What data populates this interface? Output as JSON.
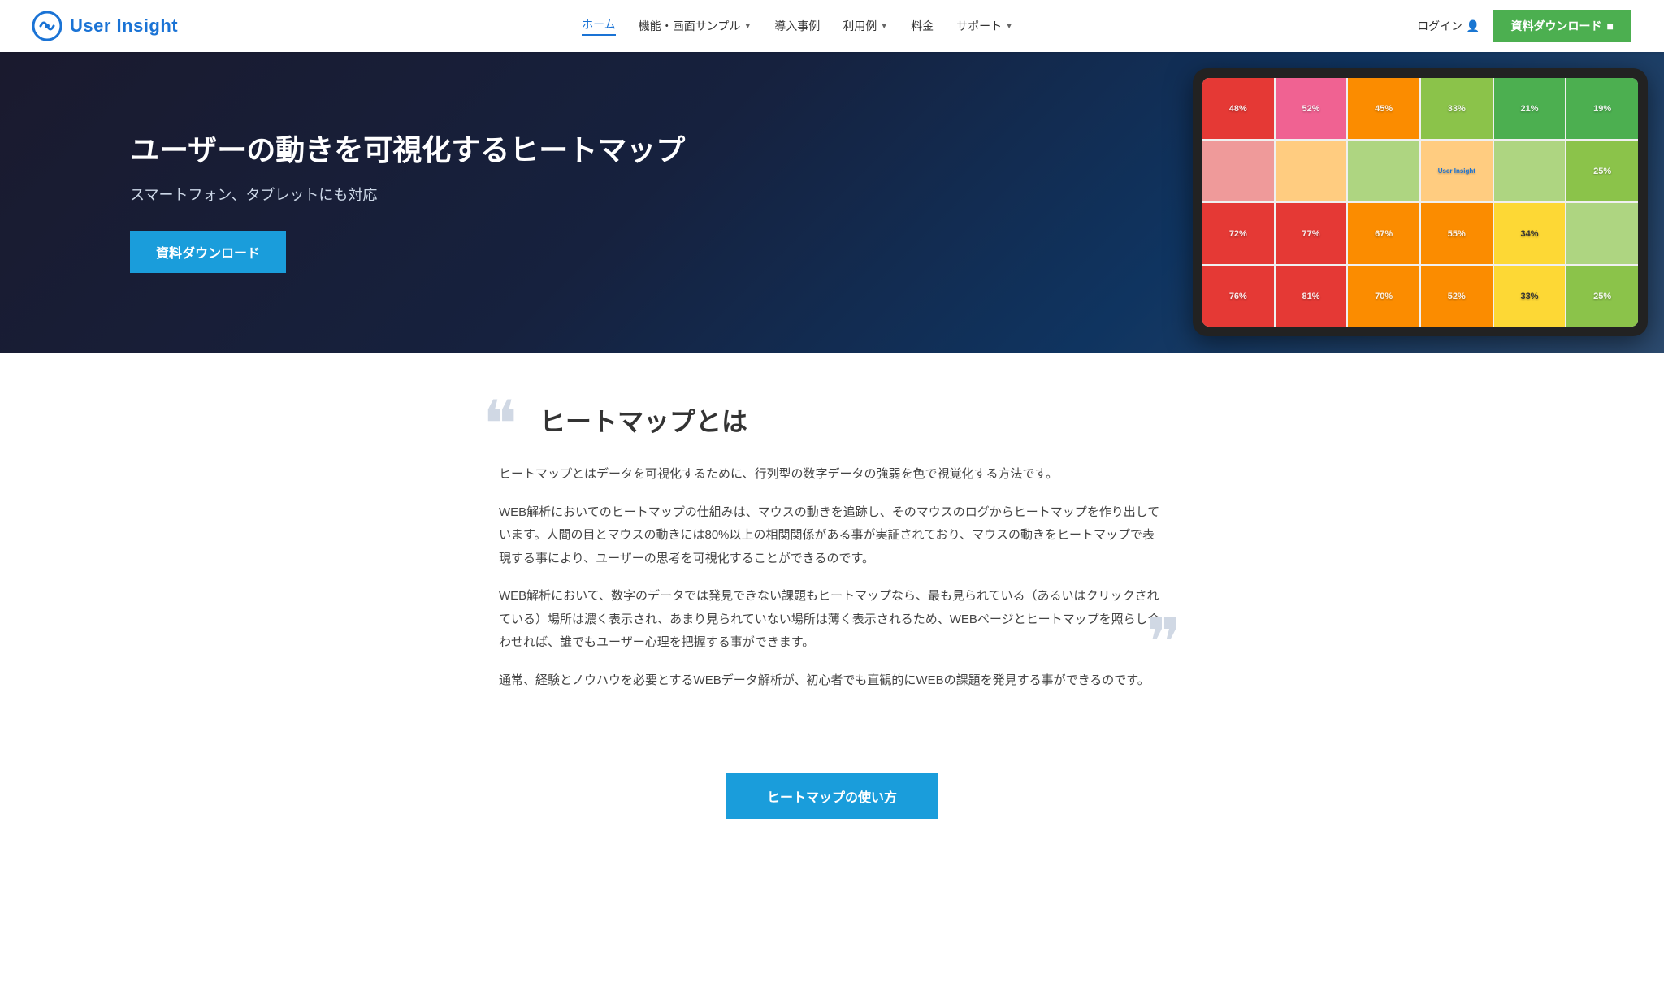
{
  "header": {
    "logo_text": "User Insight",
    "nav": {
      "home": "ホーム",
      "features": "機能・画面サンプル",
      "cases": "導入事例",
      "examples": "利用例",
      "pricing": "料金",
      "support": "サポート"
    },
    "login": "ログイン",
    "download_btn": "資料ダウンロード"
  },
  "hero": {
    "title": "ユーザーの動きを可視化するヒートマップ",
    "subtitle": "スマートフォン、タブレットにも対応",
    "cta_button": "資料ダウンロード",
    "heatmap_cells": [
      {
        "label": "48%",
        "color": "red"
      },
      {
        "label": "52%",
        "color": "pink"
      },
      {
        "label": "45%",
        "color": "orange"
      },
      {
        "label": "33%",
        "color": "light-green"
      },
      {
        "label": "21%",
        "color": "green"
      },
      {
        "label": "19%",
        "color": "green"
      },
      {
        "label": "",
        "color": "salmon"
      },
      {
        "label": "",
        "color": "peach"
      },
      {
        "label": "",
        "color": "lime"
      },
      {
        "label": "User Insight",
        "color": "peach"
      },
      {
        "label": "",
        "color": "lime"
      },
      {
        "label": "25%",
        "color": "light-green"
      },
      {
        "label": "72%",
        "color": "red"
      },
      {
        "label": "77%",
        "color": "red"
      },
      {
        "label": "67%",
        "color": "orange"
      },
      {
        "label": "55%",
        "color": "orange"
      },
      {
        "label": "34%",
        "color": "yellow"
      },
      {
        "label": "",
        "color": "lime"
      },
      {
        "label": "",
        "color": "salmon"
      },
      {
        "label": "",
        "color": "peach"
      },
      {
        "label": "",
        "color": "lime"
      },
      {
        "label": "",
        "color": "lime"
      },
      {
        "label": "",
        "color": "lime"
      },
      {
        "label": "",
        "color": "teal"
      },
      {
        "label": "76%",
        "color": "red"
      },
      {
        "label": "81%",
        "color": "red"
      },
      {
        "label": "70%",
        "color": "orange"
      },
      {
        "label": "52%",
        "color": "orange"
      },
      {
        "label": "33%",
        "color": "yellow"
      },
      {
        "label": "25%",
        "color": "light-green"
      }
    ]
  },
  "main": {
    "section_title": "ヒートマップとは",
    "paragraphs": [
      "ヒートマップとはデータを可視化するために、行列型の数字データの強弱を色で視覚化する方法です。",
      "WEB解析においてのヒートマップの仕組みは、マウスの動きを追跡し、そのマウスのログからヒートマップを作り出しています。人間の目とマウスの動きには80%以上の相関関係がある事が実証されており、マウスの動きをヒートマップで表現する事により、ユーザーの思考を可視化することができるのです。",
      "WEB解析において、数字のデータでは発見できない課題もヒートマップなら、最も見られている（あるいはクリックされている）場所は濃く表示され、あまり見られていない場所は薄く表示されるため、WEBページとヒートマップを照らし合わせれば、誰でもユーザー心理を把握する事ができます。",
      "通常、経験とノウハウを必要とするWEBデータ解析が、初心者でも直観的にWEBの課題を発見する事ができるのです。"
    ],
    "cta_button": "ヒートマップの使い方"
  }
}
